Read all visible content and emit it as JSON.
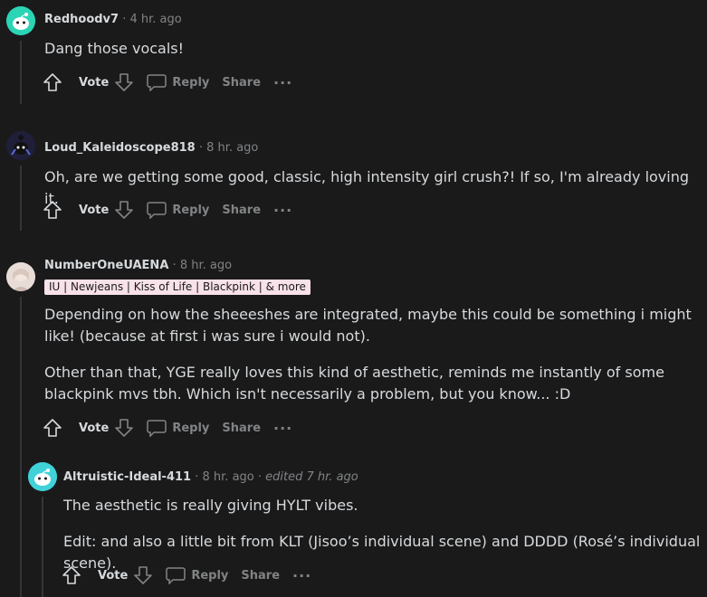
{
  "comments": [
    {
      "author": "Redhoodv7",
      "time": "4 hr. ago",
      "edited": "",
      "flair": "",
      "body": [
        "Dang those vocals!"
      ],
      "actions": {
        "vote": "Vote",
        "reply": "Reply",
        "share": "Share",
        "more": "···"
      },
      "avatar_color": "#2bd4b4"
    },
    {
      "author": "Loud_Kaleidoscope818",
      "time": "8 hr. ago",
      "edited": "",
      "flair": "",
      "body": [
        "Oh, are we getting some good, classic, high intensity girl crush?! If so, I'm already loving it."
      ],
      "actions": {
        "vote": "Vote",
        "reply": "Reply",
        "share": "Share",
        "more": "···"
      },
      "avatar_color": "#1f1f3a"
    },
    {
      "author": "NumberOneUAENA",
      "time": "8 hr. ago",
      "edited": "",
      "flair": "IU | Newjeans | Kiss of Life | Blackpink | & more",
      "body": [
        "Depending on how the sheeeshes are integrated, maybe this could be something i might like! (because at first i was sure i would not).",
        "Other than that, YGE really loves this kind of aesthetic, reminds me instantly of some blackpink mvs tbh. Which isn't necessarily a problem, but you know... :D"
      ],
      "actions": {
        "vote": "Vote",
        "reply": "Reply",
        "share": "Share",
        "more": "···"
      },
      "avatar_color": "#e8e0dc"
    },
    {
      "author": "Altruistic-Ideal-411",
      "time": "8 hr. ago",
      "edited": "edited 7 hr. ago",
      "flair": "",
      "body": [
        "The aesthetic is really giving HYLT vibes.",
        "Edit: and also a little bit from KLT (Jisoo’s individual scene) and DDDD (Rosé’s individual scene)."
      ],
      "actions": {
        "vote": "Vote",
        "reply": "Reply",
        "share": "Share",
        "more": "···"
      },
      "avatar_color": "#40d2d9"
    }
  ],
  "separator": "·"
}
